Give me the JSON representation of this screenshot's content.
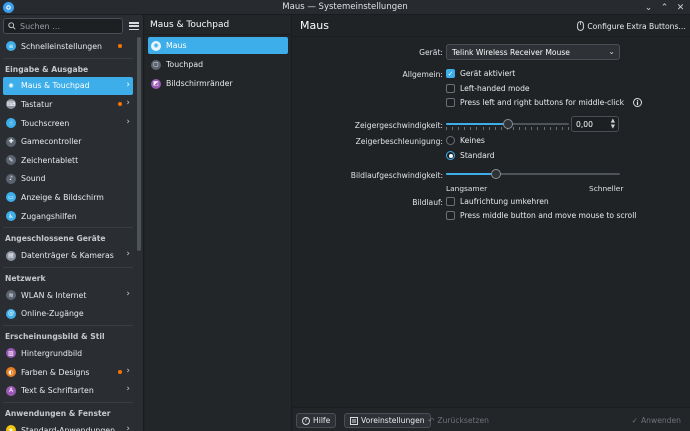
{
  "window": {
    "title": "Maus — Systemeinstellungen"
  },
  "sidebar": {
    "search_placeholder": "Suchen …",
    "top_item": {
      "label": "Schnelleinstellungen",
      "icon": "quick-settings-icon",
      "color": "#3daee9",
      "dot": true
    },
    "sections": [
      {
        "label": "Eingabe & Ausgabe",
        "items": [
          {
            "label": "Maus & Touchpad",
            "icon": "mouse-icon",
            "color": "#3daee9",
            "active": true,
            "chevron": true
          },
          {
            "label": "Tastatur",
            "icon": "keyboard-icon",
            "color": "#8b93a0",
            "dot": true,
            "chevron": true
          },
          {
            "label": "Touchscreen",
            "icon": "touchscreen-icon",
            "color": "#3daee9",
            "chevron": true
          },
          {
            "label": "Gamecontroller",
            "icon": "gamepad-icon",
            "color": "#5b6470"
          },
          {
            "label": "Zeichentablett",
            "icon": "tablet-icon",
            "color": "#5b6470"
          },
          {
            "label": "Sound",
            "icon": "speaker-icon",
            "color": "#5b6470"
          },
          {
            "label": "Anzeige & Bildschirm",
            "icon": "display-icon",
            "color": "#3daee9"
          },
          {
            "label": "Zugangshilfen",
            "icon": "accessibility-icon",
            "color": "#3daee9"
          }
        ]
      },
      {
        "label": "Angeschlossene Geräte",
        "items": [
          {
            "label": "Datenträger & Kameras",
            "icon": "drive-icon",
            "color": "#8b93a0",
            "chevron": true
          }
        ]
      },
      {
        "label": "Netzwerk",
        "items": [
          {
            "label": "WLAN & Internet",
            "icon": "network-icon",
            "color": "#5b6470",
            "chevron": true
          },
          {
            "label": "Online-Zugänge",
            "icon": "online-accounts-icon",
            "color": "#3daee9"
          }
        ]
      },
      {
        "label": "Erscheinungsbild & Stil",
        "items": [
          {
            "label": "Hintergrundbild",
            "icon": "wallpaper-icon",
            "color": "#9b59b6"
          },
          {
            "label": "Farben & Designs",
            "icon": "palette-icon",
            "color": "#e67e22",
            "dot": true,
            "chevron": true
          },
          {
            "label": "Text & Schriftarten",
            "icon": "font-icon",
            "color": "#9b59b6",
            "chevron": true
          }
        ]
      },
      {
        "label": "Anwendungen & Fenster",
        "items": [
          {
            "label": "Standard-Anwendungen",
            "icon": "star-icon",
            "color": "#f1c40f",
            "chevron": true
          }
        ]
      }
    ]
  },
  "subpanel": {
    "title": "Maus & Touchpad",
    "items": [
      {
        "label": "Maus",
        "icon": "mouse-icon",
        "active": true
      },
      {
        "label": "Touchpad",
        "icon": "touchpad-icon"
      },
      {
        "label": "Bildschirmränder",
        "icon": "screen-edges-icon"
      }
    ]
  },
  "main": {
    "title": "Maus",
    "extra_button": "Configure Extra Buttons…",
    "device": {
      "label": "Gerät:",
      "value": "Telink Wireless Receiver Mouse"
    },
    "general": {
      "label": "Allgemein:",
      "options": [
        {
          "label": "Gerät aktiviert",
          "checked": true
        },
        {
          "label": "Left-handed mode",
          "checked": false
        },
        {
          "label": "Press left and right buttons for middle-click",
          "checked": false,
          "info": true
        }
      ]
    },
    "pointer_speed": {
      "label": "Zeigergeschwindigkeit:",
      "value": "0,00",
      "level": 0.5
    },
    "acceleration": {
      "label": "Zeigerbeschleunigung:",
      "options": [
        {
          "label": "Keines",
          "selected": false
        },
        {
          "label": "Standard",
          "selected": true
        }
      ]
    },
    "scroll_speed": {
      "label": "Bildlaufgeschwindigkeit:",
      "min_label": "Langsamer",
      "max_label": "Schneller",
      "level": 0.29
    },
    "scrolling": {
      "label": "Bildlauf:",
      "options": [
        {
          "label": "Laufrichtung umkehren",
          "checked": false
        },
        {
          "label": "Press middle button and move mouse to scroll",
          "checked": false
        }
      ]
    }
  },
  "footer": {
    "help": "Hilfe",
    "defaults": "Voreinstellungen",
    "reset": "Zurücksetzen",
    "apply": "Anwenden"
  },
  "colors": {
    "accent": "#3daee9",
    "notification_dot": "#f67400"
  }
}
